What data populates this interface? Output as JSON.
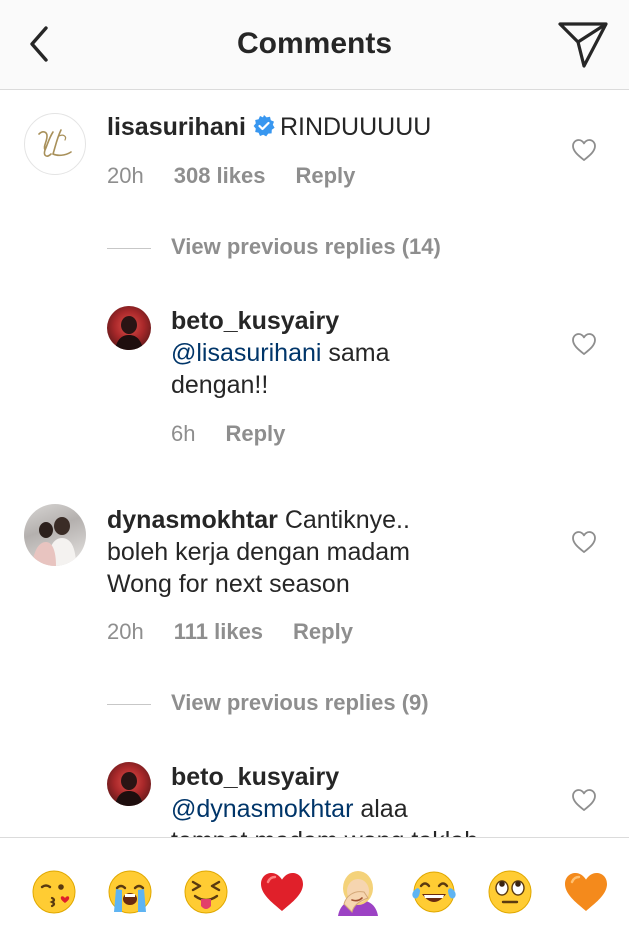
{
  "header": {
    "title": "Comments"
  },
  "comments": [
    {
      "username": "lisasurihani",
      "verified": true,
      "text": "RINDUUUUU",
      "time": "20h",
      "likes": "308 likes",
      "reply": "Reply",
      "view_previous": "View previous replies (14)",
      "replies": [
        {
          "username": "beto_kusyairy",
          "mention": "@lisasurihani",
          "text_line1": " sama",
          "text_line2": "dengan!!",
          "time": "6h",
          "reply": "Reply"
        }
      ]
    },
    {
      "username": "dynasmokhtar",
      "text_line1": " Cantiknye..",
      "text_line2": "boleh kerja dengan madam",
      "text_line3": "Wong for next season",
      "time": "20h",
      "likes": "111 likes",
      "reply": "Reply",
      "view_previous": "View previous replies (9)",
      "replies": [
        {
          "username": "beto_kusyairy",
          "mention": "@dynasmokhtar",
          "text_line1": " alaa",
          "text_line2": "tempat madam wong taklah"
        }
      ]
    }
  ],
  "emoji_bar": {
    "emojis": [
      "face-blowing-kiss",
      "loudly-crying-face",
      "squinting-tongue-face",
      "red-heart",
      "person-facepalming",
      "face-with-tears-of-joy",
      "face-with-rolling-eyes",
      "orange-heart"
    ]
  },
  "colors": {
    "text": "#262626",
    "secondary": "#8e8e8e",
    "mention": "#003569",
    "verified": "#3897f0",
    "divider": "#dbdbdb"
  }
}
